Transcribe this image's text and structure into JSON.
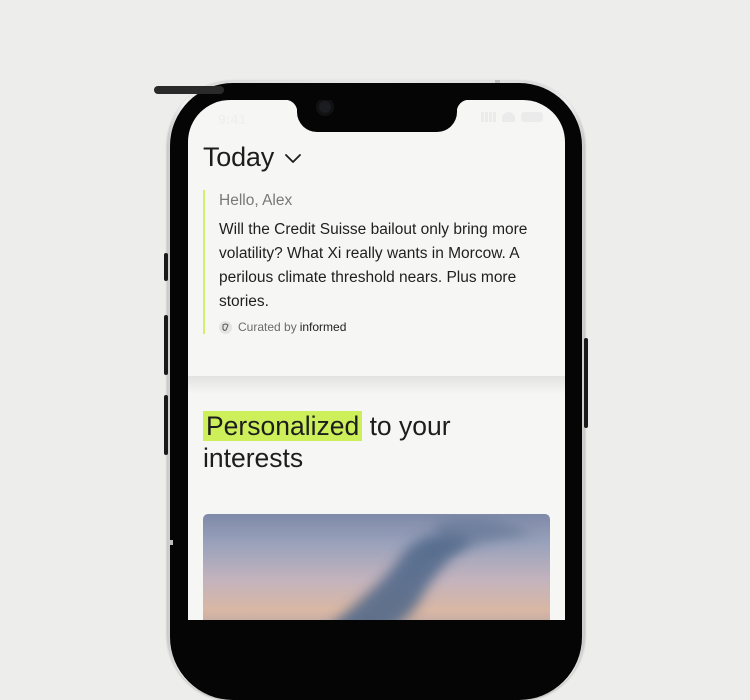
{
  "status_bar": {
    "time": "9:41"
  },
  "header": {
    "title": "Today"
  },
  "briefing": {
    "greeting": "Hello, Alex",
    "summary": "Will the Credit Suisse bailout only bring more volatility? What Xi really wants in Morcow. A perilous climate threshold nears. Plus more stories.",
    "curated_label": "Curated by",
    "curated_brand": "informed"
  },
  "section": {
    "headline_highlight": "Personalized",
    "headline_rest": " to your interests"
  },
  "colors": {
    "accent": "#cdf05a",
    "background": "#ededeb",
    "screen": "#f6f6f5"
  },
  "icons": [
    "chevron-down-icon",
    "curated-logo-icon",
    "signal-icon",
    "wifi-icon",
    "battery-icon"
  ]
}
